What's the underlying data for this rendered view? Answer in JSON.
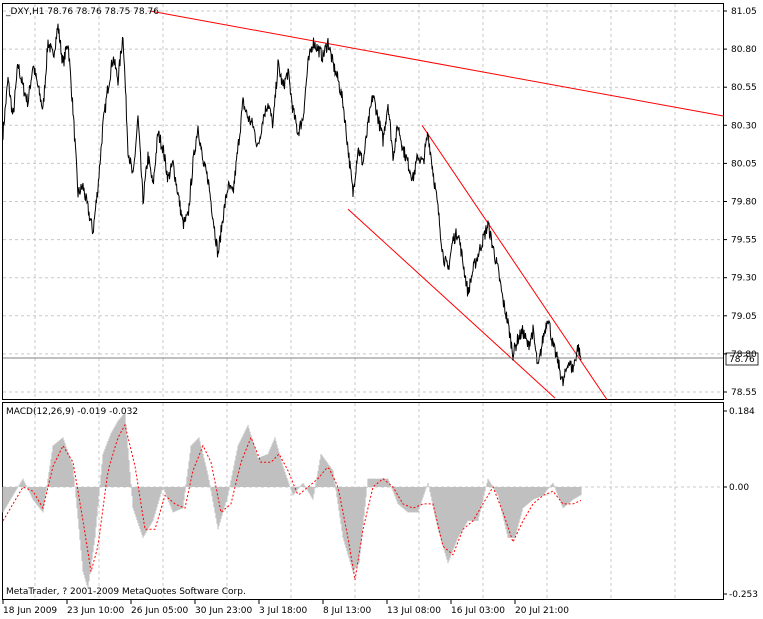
{
  "main_chart": {
    "header": "_DXY,H1  78.76 78.76 78.75 78.76",
    "current_price_label": "78.76",
    "price_ticks": [
      "81.05",
      "80.80",
      "80.55",
      "80.30",
      "80.05",
      "79.80",
      "79.55",
      "79.30",
      "79.05",
      "78.80",
      "78.55"
    ],
    "price_tick_values": [
      81.05,
      80.8,
      80.55,
      80.3,
      80.05,
      79.8,
      79.55,
      79.3,
      79.05,
      78.8,
      78.55
    ],
    "colors": {
      "price_line": "#000000",
      "trend_lines": "#ff0000",
      "grid": "#c8c8c8"
    }
  },
  "macd_panel": {
    "header": "MACD(12,26,9) -0.019 -0.032",
    "ticks": [
      "0.184",
      "0.00",
      "-0.253"
    ],
    "tick_values": [
      0.184,
      0.0,
      -0.253
    ],
    "copyright": "MetaTrader, ? 2001-2009 MetaQuotes Software Corp.",
    "colors": {
      "histogram": "#c0c0c0",
      "signal": "#ff0000"
    }
  },
  "time_axis": {
    "labels": [
      "18 Jun 2009",
      "23 Jun 10:00",
      "26 Jun 05:00",
      "30 Jun 23:00",
      "3 Jul 18:00",
      "8 Jul 13:00",
      "13 Jul 08:00",
      "16 Jul 03:00",
      "20 Jul 21:00"
    ]
  },
  "chart_data": [
    {
      "type": "line",
      "title": "_DXY,H1",
      "series": [
        {
          "name": "_DXY",
          "anchors": [
            [
              0,
              80.25
            ],
            [
              5,
              80.6
            ],
            [
              10,
              80.35
            ],
            [
              15,
              80.7
            ],
            [
              20,
              80.55
            ],
            [
              25,
              80.45
            ],
            [
              30,
              80.7
            ],
            [
              35,
              80.55
            ],
            [
              40,
              80.4
            ],
            [
              45,
              80.85
            ],
            [
              50,
              80.75
            ],
            [
              55,
              80.95
            ],
            [
              60,
              80.7
            ],
            [
              65,
              80.85
            ],
            [
              70,
              80.4
            ],
            [
              75,
              79.85
            ],
            [
              80,
              79.9
            ],
            [
              85,
              79.75
            ],
            [
              90,
              79.6
            ],
            [
              95,
              79.9
            ],
            [
              100,
              80.3
            ],
            [
              105,
              80.55
            ],
            [
              110,
              80.75
            ],
            [
              115,
              80.6
            ],
            [
              120,
              80.9
            ],
            [
              125,
              80.15
            ],
            [
              130,
              79.95
            ],
            [
              135,
              80.35
            ],
            [
              140,
              79.8
            ],
            [
              145,
              80.1
            ],
            [
              150,
              79.9
            ],
            [
              155,
              80.25
            ],
            [
              160,
              80.15
            ],
            [
              165,
              79.95
            ],
            [
              170,
              80.05
            ],
            [
              175,
              79.85
            ],
            [
              180,
              79.65
            ],
            [
              185,
              79.7
            ],
            [
              190,
              80.05
            ],
            [
              195,
              80.3
            ],
            [
              200,
              80.05
            ],
            [
              205,
              79.95
            ],
            [
              210,
              79.7
            ],
            [
              215,
              79.45
            ],
            [
              220,
              79.7
            ],
            [
              225,
              79.9
            ],
            [
              230,
              79.85
            ],
            [
              235,
              80.15
            ],
            [
              240,
              80.45
            ],
            [
              245,
              80.35
            ],
            [
              250,
              80.3
            ],
            [
              255,
              80.15
            ],
            [
              260,
              80.35
            ],
            [
              265,
              80.45
            ],
            [
              270,
              80.3
            ],
            [
              275,
              80.7
            ],
            [
              280,
              80.55
            ],
            [
              285,
              80.65
            ],
            [
              290,
              80.4
            ],
            [
              295,
              80.25
            ],
            [
              300,
              80.35
            ],
            [
              305,
              80.7
            ],
            [
              310,
              80.85
            ],
            [
              315,
              80.8
            ],
            [
              320,
              80.75
            ],
            [
              325,
              80.85
            ],
            [
              330,
              80.7
            ],
            [
              335,
              80.6
            ],
            [
              340,
              80.45
            ],
            [
              345,
              80.15
            ],
            [
              350,
              79.85
            ],
            [
              355,
              80.15
            ],
            [
              360,
              80.05
            ],
            [
              365,
              80.3
            ],
            [
              370,
              80.5
            ],
            [
              375,
              80.35
            ],
            [
              380,
              80.2
            ],
            [
              385,
              80.45
            ],
            [
              390,
              80.1
            ],
            [
              395,
              80.3
            ],
            [
              400,
              80.15
            ],
            [
              405,
              80.05
            ],
            [
              410,
              79.95
            ],
            [
              415,
              80.1
            ],
            [
              420,
              80.05
            ],
            [
              425,
              80.25
            ],
            [
              430,
              80.0
            ],
            [
              435,
              79.75
            ],
            [
              440,
              79.45
            ],
            [
              445,
              79.35
            ],
            [
              450,
              79.55
            ],
            [
              455,
              79.6
            ],
            [
              460,
              79.4
            ],
            [
              465,
              79.2
            ],
            [
              470,
              79.35
            ],
            [
              475,
              79.45
            ],
            [
              480,
              79.55
            ],
            [
              485,
              79.65
            ],
            [
              490,
              79.5
            ],
            [
              495,
              79.35
            ],
            [
              500,
              79.15
            ],
            [
              505,
              79.0
            ],
            [
              510,
              78.8
            ],
            [
              515,
              78.9
            ],
            [
              520,
              78.95
            ],
            [
              525,
              78.85
            ],
            [
              530,
              78.95
            ],
            [
              535,
              78.7
            ],
            [
              540,
              78.9
            ],
            [
              545,
              79.05
            ],
            [
              550,
              78.85
            ],
            [
              555,
              78.75
            ],
            [
              560,
              78.6
            ],
            [
              565,
              78.75
            ],
            [
              570,
              78.7
            ],
            [
              575,
              78.85
            ],
            [
              578,
              78.76
            ]
          ]
        }
      ],
      "trend_lines": [
        {
          "from": [
            150,
            81.05
          ],
          "to": [
            724,
            80.36
          ]
        },
        {
          "from": [
            422,
            80.3
          ],
          "to": [
            607,
            78.5
          ]
        },
        {
          "from": [
            348,
            79.75
          ],
          "to": [
            555,
            78.51
          ]
        }
      ],
      "ylim": [
        78.5,
        81.08
      ],
      "grid": true
    },
    {
      "type": "area",
      "title": "MACD(12,26,9)",
      "series": [
        {
          "name": "MACD",
          "anchors": [
            [
              0,
              -0.06
            ],
            [
              10,
              -0.02
            ],
            [
              20,
              0.02
            ],
            [
              30,
              -0.03
            ],
            [
              40,
              -0.06
            ],
            [
              50,
              0.1
            ],
            [
              60,
              0.12
            ],
            [
              70,
              0.05
            ],
            [
              80,
              -0.2
            ],
            [
              85,
              -0.24
            ],
            [
              92,
              -0.12
            ],
            [
              100,
              0.08
            ],
            [
              108,
              0.13
            ],
            [
              115,
              0.16
            ],
            [
              122,
              0.18
            ],
            [
              130,
              -0.05
            ],
            [
              140,
              -0.12
            ],
            [
              150,
              -0.08
            ],
            [
              160,
              0.0
            ],
            [
              170,
              -0.06
            ],
            [
              180,
              -0.05
            ],
            [
              188,
              0.1
            ],
            [
              196,
              0.12
            ],
            [
              205,
              0.03
            ],
            [
              215,
              -0.1
            ],
            [
              225,
              -0.02
            ],
            [
              235,
              0.1
            ],
            [
              245,
              0.15
            ],
            [
              255,
              0.07
            ],
            [
              265,
              0.08
            ],
            [
              272,
              0.12
            ],
            [
              280,
              0.05
            ],
            [
              290,
              -0.02
            ],
            [
              300,
              0.01
            ],
            [
              310,
              -0.03
            ],
            [
              318,
              0.08
            ],
            [
              330,
              0.04
            ],
            [
              340,
              -0.12
            ],
            [
              350,
              -0.2
            ],
            [
              356,
              -0.18
            ],
            [
              365,
              0.02
            ],
            [
              375,
              0.02
            ],
            [
              385,
              0.02
            ],
            [
              395,
              -0.04
            ],
            [
              405,
              -0.06
            ],
            [
              415,
              -0.06
            ],
            [
              425,
              0.01
            ],
            [
              435,
              -0.1
            ],
            [
              445,
              -0.18
            ],
            [
              455,
              -0.12
            ],
            [
              465,
              -0.08
            ],
            [
              475,
              -0.08
            ],
            [
              485,
              0.02
            ],
            [
              495,
              -0.02
            ],
            [
              505,
              -0.12
            ],
            [
              512,
              -0.12
            ],
            [
              520,
              -0.05
            ],
            [
              530,
              -0.03
            ],
            [
              540,
              -0.02
            ],
            [
              550,
              0.01
            ],
            [
              560,
              -0.05
            ],
            [
              570,
              -0.03
            ],
            [
              578,
              -0.019
            ]
          ]
        },
        {
          "name": "Signal",
          "anchors": [
            [
              0,
              -0.08
            ],
            [
              10,
              -0.04
            ],
            [
              20,
              0.0
            ],
            [
              30,
              -0.01
            ],
            [
              40,
              -0.05
            ],
            [
              50,
              0.05
            ],
            [
              60,
              0.1
            ],
            [
              70,
              0.06
            ],
            [
              80,
              -0.08
            ],
            [
              88,
              -0.2
            ],
            [
              95,
              -0.14
            ],
            [
              105,
              0.04
            ],
            [
              115,
              0.12
            ],
            [
              122,
              0.15
            ],
            [
              132,
              0.05
            ],
            [
              142,
              -0.1
            ],
            [
              152,
              -0.1
            ],
            [
              162,
              -0.02
            ],
            [
              172,
              -0.04
            ],
            [
              182,
              -0.05
            ],
            [
              190,
              0.04
            ],
            [
              200,
              0.1
            ],
            [
              208,
              0.06
            ],
            [
              218,
              -0.06
            ],
            [
              228,
              -0.04
            ],
            [
              238,
              0.06
            ],
            [
              248,
              0.12
            ],
            [
              258,
              0.06
            ],
            [
              268,
              0.06
            ],
            [
              276,
              0.08
            ],
            [
              285,
              0.04
            ],
            [
              295,
              -0.02
            ],
            [
              305,
              0.0
            ],
            [
              315,
              0.02
            ],
            [
              325,
              0.05
            ],
            [
              335,
              0.0
            ],
            [
              345,
              -0.12
            ],
            [
              352,
              -0.22
            ],
            [
              360,
              -0.1
            ],
            [
              370,
              0.0
            ],
            [
              380,
              0.02
            ],
            [
              390,
              0.0
            ],
            [
              400,
              -0.04
            ],
            [
              410,
              -0.05
            ],
            [
              420,
              -0.04
            ],
            [
              430,
              -0.04
            ],
            [
              440,
              -0.14
            ],
            [
              450,
              -0.16
            ],
            [
              460,
              -0.1
            ],
            [
              470,
              -0.08
            ],
            [
              480,
              -0.04
            ],
            [
              490,
              0.0
            ],
            [
              500,
              -0.06
            ],
            [
              510,
              -0.13
            ],
            [
              520,
              -0.08
            ],
            [
              530,
              -0.04
            ],
            [
              540,
              -0.02
            ],
            [
              550,
              -0.01
            ],
            [
              560,
              -0.04
            ],
            [
              570,
              -0.04
            ],
            [
              578,
              -0.032
            ]
          ]
        }
      ],
      "ylim": [
        -0.253,
        0.184
      ],
      "grid": true
    }
  ]
}
